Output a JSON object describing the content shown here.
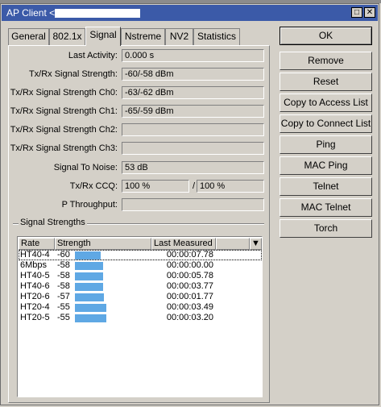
{
  "window": {
    "title": "AP Client <"
  },
  "tabs": [
    {
      "label": "General"
    },
    {
      "label": "802.1x"
    },
    {
      "label": "Signal"
    },
    {
      "label": "Nstreme"
    },
    {
      "label": "NV2"
    },
    {
      "label": "Statistics"
    }
  ],
  "active_tab": "Signal",
  "fields": {
    "last_activity": {
      "label": "Last Activity:",
      "value": "0.000 s"
    },
    "tx_rx_signal": {
      "label": "Tx/Rx Signal Strength:",
      "value": "-60/-58 dBm"
    },
    "ch0": {
      "label": "Tx/Rx Signal Strength Ch0:",
      "value": "-63/-62 dBm"
    },
    "ch1": {
      "label": "Tx/Rx Signal Strength Ch1:",
      "value": "-65/-59 dBm"
    },
    "ch2": {
      "label": "Tx/Rx Signal Strength Ch2:",
      "value": ""
    },
    "ch3": {
      "label": "Tx/Rx Signal Strength Ch3:",
      "value": ""
    },
    "snr": {
      "label": "Signal To Noise:",
      "value": "53 dB"
    },
    "ccq": {
      "label": "Tx/Rx CCQ:",
      "tx": "100 %",
      "sep": "/",
      "rx": "100 %"
    },
    "p_throughput": {
      "label": "P Throughput:",
      "value": ""
    }
  },
  "signal_group": {
    "label": "Signal Strengths",
    "columns": [
      "Rate",
      "Strength",
      "Last Measured"
    ],
    "rows": [
      {
        "rate": "HT40-4",
        "strength": "-60",
        "last": "00:00:07.78",
        "level": 0.53
      },
      {
        "rate": "6Mbps",
        "strength": "-58",
        "last": "00:00:00.00",
        "level": 0.58
      },
      {
        "rate": "HT40-5",
        "strength": "-58",
        "last": "00:00:05.78",
        "level": 0.58
      },
      {
        "rate": "HT40-6",
        "strength": "-58",
        "last": "00:00:03.77",
        "level": 0.58
      },
      {
        "rate": "HT20-6",
        "strength": "-57",
        "last": "00:00:01.77",
        "level": 0.6
      },
      {
        "rate": "HT20-4",
        "strength": "-55",
        "last": "00:00:03.49",
        "level": 0.65
      },
      {
        "rate": "HT20-5",
        "strength": "-55",
        "last": "00:00:03.20",
        "level": 0.65
      }
    ]
  },
  "buttons": [
    {
      "label": "OK"
    },
    {
      "label": "Remove"
    },
    {
      "label": "Reset"
    },
    {
      "label": "Copy to Access List"
    },
    {
      "label": "Copy to Connect List"
    },
    {
      "label": "Ping"
    },
    {
      "label": "MAC Ping"
    },
    {
      "label": "Telnet"
    },
    {
      "label": "MAC Telnet"
    },
    {
      "label": "Torch"
    }
  ],
  "colors": {
    "titlebar": "#3b5aa8",
    "bar": "#5fa8e4"
  }
}
